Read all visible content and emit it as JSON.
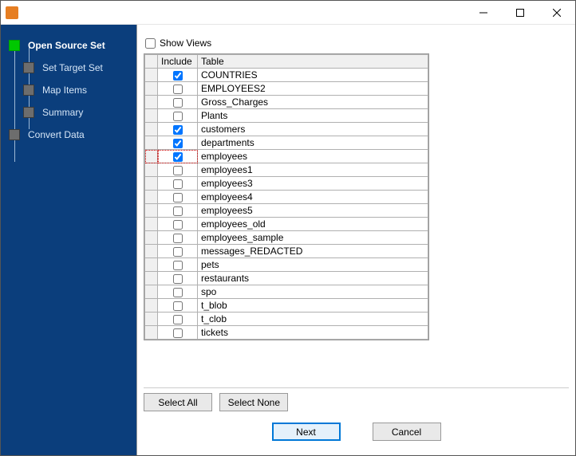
{
  "window": {
    "title": ""
  },
  "titlebar_icons": {
    "minimize": "minimize-icon",
    "maximize": "maximize-icon",
    "close": "close-icon"
  },
  "sidebar": {
    "items": [
      {
        "label": "Open Source Set",
        "active": true,
        "sub": false
      },
      {
        "label": "Set Target Set",
        "active": false,
        "sub": true
      },
      {
        "label": "Map Items",
        "active": false,
        "sub": true
      },
      {
        "label": "Summary",
        "active": false,
        "sub": true
      },
      {
        "label": "Convert Data",
        "active": false,
        "sub": false
      }
    ]
  },
  "main": {
    "show_views_label": "Show Views",
    "show_views_checked": false,
    "columns": {
      "include": "Include",
      "table": "Table"
    },
    "rows": [
      {
        "include": true,
        "name": "COUNTRIES",
        "highlight": false
      },
      {
        "include": false,
        "name": "EMPLOYEES2",
        "highlight": false
      },
      {
        "include": false,
        "name": "Gross_Charges",
        "highlight": false
      },
      {
        "include": false,
        "name": "Plants",
        "highlight": false
      },
      {
        "include": true,
        "name": "customers",
        "highlight": false
      },
      {
        "include": true,
        "name": "departments",
        "highlight": false
      },
      {
        "include": true,
        "name": "employees",
        "highlight": true
      },
      {
        "include": false,
        "name": "employees1",
        "highlight": false
      },
      {
        "include": false,
        "name": "employees3",
        "highlight": false
      },
      {
        "include": false,
        "name": "employees4",
        "highlight": false
      },
      {
        "include": false,
        "name": "employees5",
        "highlight": false
      },
      {
        "include": false,
        "name": "employees_old",
        "highlight": false
      },
      {
        "include": false,
        "name": "employees_sample",
        "highlight": false
      },
      {
        "include": false,
        "name": "messages_REDACTED",
        "highlight": false
      },
      {
        "include": false,
        "name": "pets",
        "highlight": false
      },
      {
        "include": false,
        "name": "restaurants",
        "highlight": false
      },
      {
        "include": false,
        "name": "spo",
        "highlight": false
      },
      {
        "include": false,
        "name": "t_blob",
        "highlight": false
      },
      {
        "include": false,
        "name": "t_clob",
        "highlight": false
      },
      {
        "include": false,
        "name": "tickets",
        "highlight": false
      }
    ],
    "select_all": "Select All",
    "select_none": "Select None"
  },
  "footer": {
    "next": "Next",
    "cancel": "Cancel"
  }
}
